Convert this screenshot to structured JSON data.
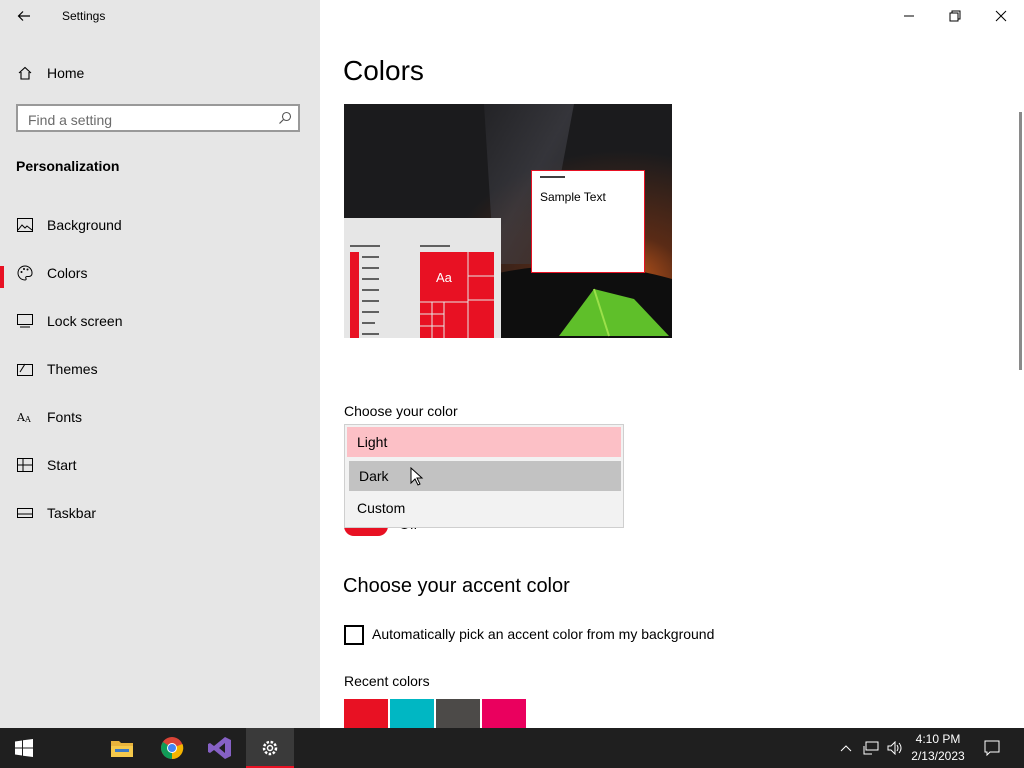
{
  "window": {
    "app_title": "Settings",
    "controls": [
      "minimize-icon",
      "restore-icon",
      "close-icon"
    ]
  },
  "sidebar": {
    "home_label": "Home",
    "search_placeholder": "Find a setting",
    "section_title": "Personalization",
    "items": [
      {
        "label": "Background",
        "icon": "picture-icon",
        "selected": false
      },
      {
        "label": "Colors",
        "icon": "palette-icon",
        "selected": true
      },
      {
        "label": "Lock screen",
        "icon": "lock-screen-icon",
        "selected": false
      },
      {
        "label": "Themes",
        "icon": "themes-icon",
        "selected": false
      },
      {
        "label": "Fonts",
        "icon": "fonts-icon",
        "selected": false
      },
      {
        "label": "Start",
        "icon": "start-icon",
        "selected": false
      },
      {
        "label": "Taskbar",
        "icon": "taskbar-icon",
        "selected": false
      }
    ]
  },
  "main": {
    "page_title": "Colors",
    "preview": {
      "sample_text": "Sample Text",
      "tile_label": "Aa",
      "accent_color": "#e81123"
    },
    "choose_color_label": "Choose your color",
    "dropdown_options": [
      {
        "label": "Light",
        "state": "selected"
      },
      {
        "label": "Dark",
        "state": "hover"
      },
      {
        "label": "Custom",
        "state": "normal"
      }
    ],
    "toggle_partial_text": "Off",
    "accent_heading": "Choose your accent color",
    "auto_pick_label": "Automatically pick an accent color from my background",
    "auto_pick_checked": false,
    "recent_colors_label": "Recent colors",
    "recent_colors": [
      "#e81123",
      "#00b7c3",
      "#4c4a48",
      "#ea005e"
    ]
  },
  "taskbar": {
    "apps": [
      "windows-start-icon",
      "file-explorer-icon",
      "chrome-icon",
      "visual-studio-icon",
      "settings-gear-icon"
    ],
    "time": "4:10 PM",
    "date": "2/13/2023"
  }
}
